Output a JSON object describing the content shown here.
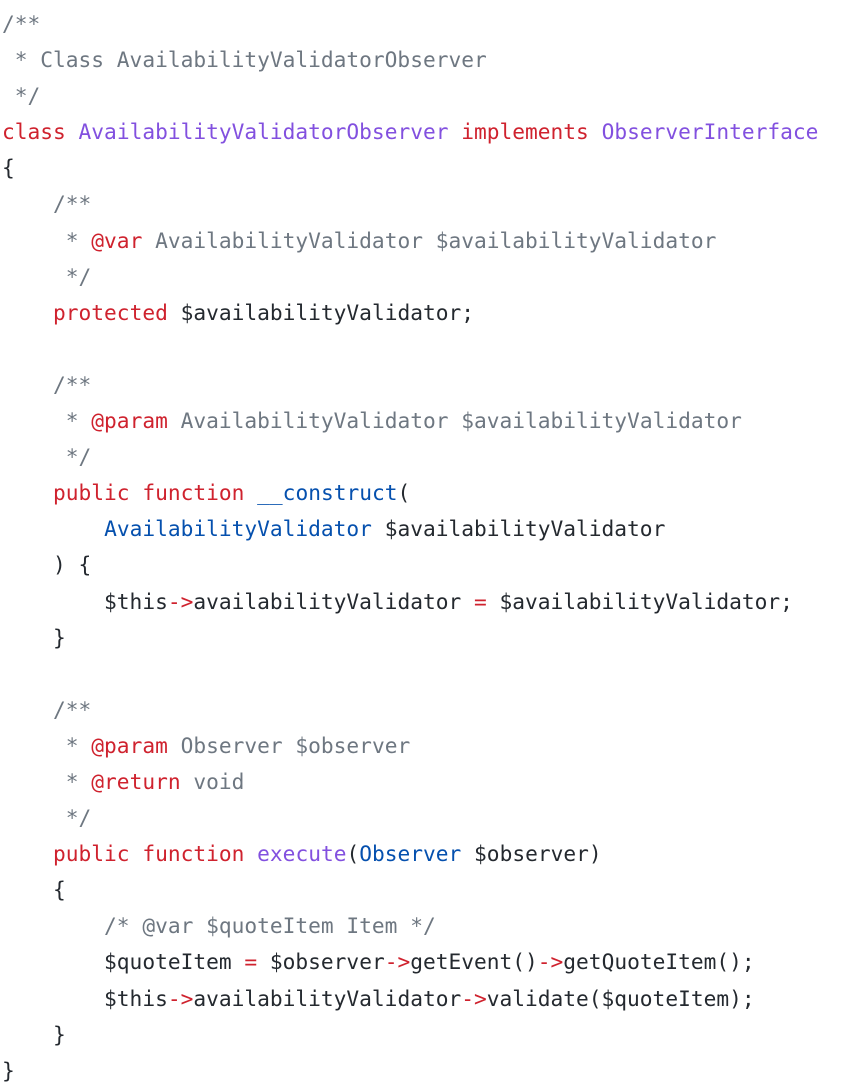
{
  "code_block": {
    "language": "php",
    "colors": {
      "comment": "#6e7781",
      "keyword": "#cf222e",
      "title": "#8250df",
      "type": "#0550ae",
      "plain": "#24292f",
      "background": "#ffffff"
    },
    "lines": [
      [
        {
          "t": "/**",
          "k": "comment"
        }
      ],
      [
        {
          "t": " * Class AvailabilityValidatorObserver",
          "k": "comment"
        }
      ],
      [
        {
          "t": " */",
          "k": "comment"
        }
      ],
      [
        {
          "t": "class",
          "k": "keyword"
        },
        {
          "t": " ",
          "k": "plain"
        },
        {
          "t": "AvailabilityValidatorObserver",
          "k": "title"
        },
        {
          "t": " ",
          "k": "plain"
        },
        {
          "t": "implements",
          "k": "keyword"
        },
        {
          "t": " ",
          "k": "plain"
        },
        {
          "t": "ObserverInterface",
          "k": "title"
        }
      ],
      [
        {
          "t": "{",
          "k": "plain"
        }
      ],
      [
        {
          "t": "    /**",
          "k": "comment"
        }
      ],
      [
        {
          "t": "     * ",
          "k": "comment"
        },
        {
          "t": "@var",
          "k": "keyword"
        },
        {
          "t": " AvailabilityValidator $availabilityValidator",
          "k": "comment"
        }
      ],
      [
        {
          "t": "     */",
          "k": "comment"
        }
      ],
      [
        {
          "t": "    ",
          "k": "plain"
        },
        {
          "t": "protected",
          "k": "keyword"
        },
        {
          "t": " $availabilityValidator;",
          "k": "plain"
        }
      ],
      [
        {
          "t": "",
          "k": "plain"
        }
      ],
      [
        {
          "t": "    /**",
          "k": "comment"
        }
      ],
      [
        {
          "t": "     * ",
          "k": "comment"
        },
        {
          "t": "@param",
          "k": "keyword"
        },
        {
          "t": " AvailabilityValidator $availabilityValidator",
          "k": "comment"
        }
      ],
      [
        {
          "t": "     */",
          "k": "comment"
        }
      ],
      [
        {
          "t": "    ",
          "k": "plain"
        },
        {
          "t": "public",
          "k": "keyword"
        },
        {
          "t": " ",
          "k": "plain"
        },
        {
          "t": "function",
          "k": "keyword"
        },
        {
          "t": " ",
          "k": "plain"
        },
        {
          "t": "__construct",
          "k": "type"
        },
        {
          "t": "(",
          "k": "plain"
        }
      ],
      [
        {
          "t": "        ",
          "k": "plain"
        },
        {
          "t": "AvailabilityValidator",
          "k": "type"
        },
        {
          "t": " $availabilityValidator",
          "k": "plain"
        }
      ],
      [
        {
          "t": "    ) {",
          "k": "plain"
        }
      ],
      [
        {
          "t": "        $this",
          "k": "plain"
        },
        {
          "t": "->",
          "k": "keyword"
        },
        {
          "t": "availabilityValidator ",
          "k": "plain"
        },
        {
          "t": "=",
          "k": "keyword"
        },
        {
          "t": " $availabilityValidator;",
          "k": "plain"
        }
      ],
      [
        {
          "t": "    }",
          "k": "plain"
        }
      ],
      [
        {
          "t": "",
          "k": "plain"
        }
      ],
      [
        {
          "t": "    /**",
          "k": "comment"
        }
      ],
      [
        {
          "t": "     * ",
          "k": "comment"
        },
        {
          "t": "@param",
          "k": "keyword"
        },
        {
          "t": " Observer $observer",
          "k": "comment"
        }
      ],
      [
        {
          "t": "     * ",
          "k": "comment"
        },
        {
          "t": "@return",
          "k": "keyword"
        },
        {
          "t": " void",
          "k": "comment"
        }
      ],
      [
        {
          "t": "     */",
          "k": "comment"
        }
      ],
      [
        {
          "t": "    ",
          "k": "plain"
        },
        {
          "t": "public",
          "k": "keyword"
        },
        {
          "t": " ",
          "k": "plain"
        },
        {
          "t": "function",
          "k": "keyword"
        },
        {
          "t": " ",
          "k": "plain"
        },
        {
          "t": "execute",
          "k": "title"
        },
        {
          "t": "(",
          "k": "plain"
        },
        {
          "t": "Observer",
          "k": "type"
        },
        {
          "t": " $observer)",
          "k": "plain"
        }
      ],
      [
        {
          "t": "    {",
          "k": "plain"
        }
      ],
      [
        {
          "t": "        /* @var $quoteItem Item */",
          "k": "comment"
        }
      ],
      [
        {
          "t": "        $quoteItem ",
          "k": "plain"
        },
        {
          "t": "=",
          "k": "keyword"
        },
        {
          "t": " $observer",
          "k": "plain"
        },
        {
          "t": "->",
          "k": "keyword"
        },
        {
          "t": "getEvent()",
          "k": "plain"
        },
        {
          "t": "->",
          "k": "keyword"
        },
        {
          "t": "getQuoteItem();",
          "k": "plain"
        }
      ],
      [
        {
          "t": "        $this",
          "k": "plain"
        },
        {
          "t": "->",
          "k": "keyword"
        },
        {
          "t": "availabilityValidator",
          "k": "plain"
        },
        {
          "t": "->",
          "k": "keyword"
        },
        {
          "t": "validate($quoteItem);",
          "k": "plain"
        }
      ],
      [
        {
          "t": "    }",
          "k": "plain"
        }
      ],
      [
        {
          "t": "}",
          "k": "plain"
        }
      ]
    ]
  }
}
